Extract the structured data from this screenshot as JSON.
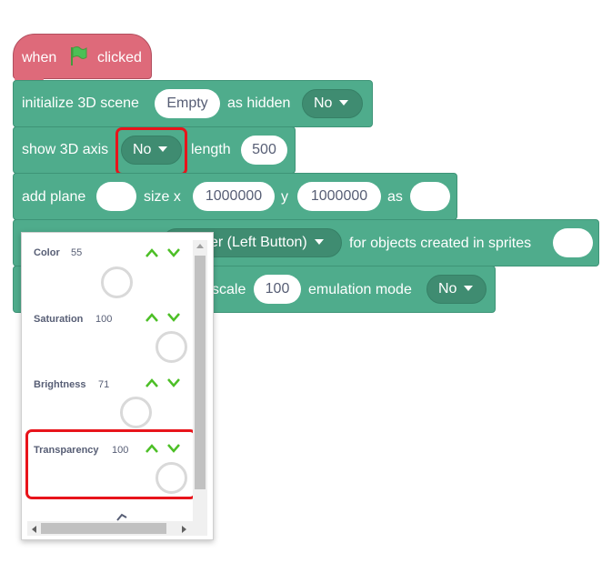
{
  "hat": {
    "when": "when",
    "clicked": "clicked",
    "flag_color": "#4cbf56"
  },
  "init": {
    "label": "initialize 3D scene",
    "scene_value": "Empty",
    "as_hidden": "as hidden",
    "hidden_value": "No"
  },
  "axis": {
    "label": "show 3D axis",
    "value": "No",
    "length_label": "length",
    "length_value": "500"
  },
  "plane": {
    "label": "add plane",
    "size_x": "size x",
    "x_value": "1000000",
    "y": "y",
    "y_value": "1000000",
    "as": "as"
  },
  "row4": {
    "dropdown_partial": "er (Left Button)",
    "suffix": "for objects created in sprites"
  },
  "row5": {
    "scale": "scale",
    "scale_value": "100",
    "emulation": "emulation mode",
    "emulation_value": "No"
  },
  "color_picker": {
    "items": [
      {
        "label": "Color",
        "value": "55"
      },
      {
        "label": "Saturation",
        "value": "100"
      },
      {
        "label": "Brightness",
        "value": "71"
      },
      {
        "label": "Transparency",
        "value": "100"
      }
    ]
  },
  "colors": {
    "block_green": "#4fac8c",
    "hat_pink": "#de6a7a",
    "highlight_red": "#e8141b",
    "arrow_green": "#4cbf26"
  }
}
